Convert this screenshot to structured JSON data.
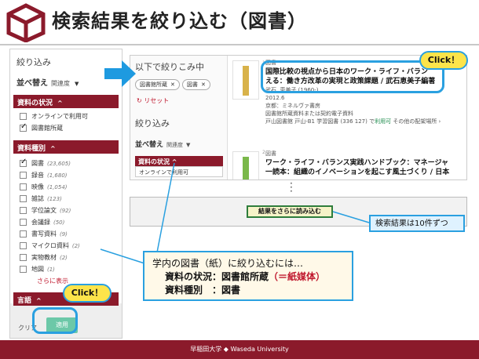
{
  "slide": {
    "title": "検索結果を絞り込む（図書）",
    "footer": "早稲田大学 ◆ Waseda University"
  },
  "left_panel": {
    "heading": "絞り込み",
    "sort_label": "並べ替え",
    "sort_value": "関連度",
    "status_section": {
      "title": "資料の状況",
      "options": [
        {
          "label": "オンラインで利用可",
          "checked": false
        },
        {
          "label": "図書館所蔵",
          "checked": true
        }
      ]
    },
    "type_section": {
      "title": "資料種別",
      "options": [
        {
          "label": "図書",
          "count": "(23,605)",
          "checked": true
        },
        {
          "label": "録音",
          "count": "(1,680)",
          "checked": false
        },
        {
          "label": "映像",
          "count": "(1,054)",
          "checked": false
        },
        {
          "label": "雑誌",
          "count": "(123)",
          "checked": false
        },
        {
          "label": "学位論文",
          "count": "(92)",
          "checked": false
        },
        {
          "label": "会議録",
          "count": "(50)",
          "checked": false
        },
        {
          "label": "書写資料",
          "count": "(9)",
          "checked": false
        },
        {
          "label": "マイクロ資料",
          "count": "(2)",
          "checked": false
        },
        {
          "label": "実物教材",
          "count": "(2)",
          "checked": false
        },
        {
          "label": "地図",
          "count": "(1)",
          "checked": false
        }
      ],
      "more": "さらに表示"
    },
    "language_section": {
      "title": "言語"
    },
    "clear_button": "クリア",
    "apply_button": "適用"
  },
  "results_panel": {
    "heading": "以下で絞りこみ中",
    "chips": [
      "図書館所蔵",
      "図書"
    ],
    "reset": "リセット",
    "refine_heading": "絞り込み",
    "sort_label": "並べ替え",
    "sort_value": "関連度",
    "status_title": "資料の状況",
    "status_option": "オンラインで利用可",
    "records": [
      {
        "type": "図書",
        "title_line1": "国際比較の視点から日本のワーク・ライフ・バラン",
        "title_line2": "える：働き方改革の実現と政策課題 / 武石恵美子編著",
        "meta1": "武石, 恵美子 (1960-)",
        "meta2": "2012.6",
        "meta3": "京都：ミネルヴァ書房",
        "meta4": "図書館所蔵資料または契約電子資料",
        "avail_prefix": "戸山図書館  戸山-B1 学習図書 (336 127) で",
        "avail_green": "利用可",
        "avail_suffix": " その他の配架場所 ›"
      },
      {
        "type": "図書",
        "title_line1": "ワーク・ライフ・バランス実践ハンドブック：マネージャ",
        "title_line2": "一読本：組織のイノベーションを起こす風土づくり / 日本"
      }
    ],
    "read_more": "結果をさらに読み込む"
  },
  "callouts": {
    "click_top": "Click！",
    "click_bottom": "Click！",
    "per_page_note": "検索結果は10件ずつ",
    "explain_line1": "学内の図書（紙）に絞り込むには…",
    "explain_row1_label": "資料の状況：図書館所蔵",
    "explain_row1_red": "（＝紙媒体）",
    "explain_row2": "資料種別　：図書"
  },
  "colors": {
    "brand": "#8b1a2b",
    "callout_border": "#2aa0e0",
    "click_bg": "#fde44a",
    "apply_button": "#6cc8a8"
  }
}
